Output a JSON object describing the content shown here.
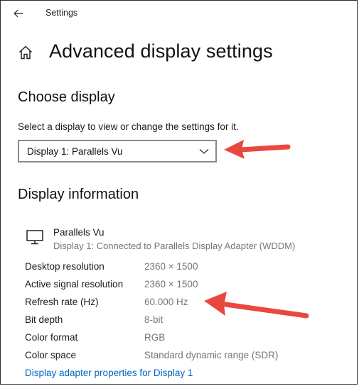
{
  "window": {
    "title": "Settings"
  },
  "page": {
    "title": "Advanced display settings"
  },
  "choose_display": {
    "heading": "Choose display",
    "label": "Select a display to view or change the settings for it.",
    "selected": "Display 1: Parallels Vu"
  },
  "display_info": {
    "heading": "Display information",
    "name": "Parallels Vu",
    "connection": "Display 1: Connected to Parallels Display Adapter (WDDM)",
    "rows": [
      {
        "label": "Desktop resolution",
        "value": "2360 × 1500"
      },
      {
        "label": "Active signal resolution",
        "value": "2360 × 1500"
      },
      {
        "label": "Refresh rate (Hz)",
        "value": "60.000 Hz"
      },
      {
        "label": "Bit depth",
        "value": "8-bit"
      },
      {
        "label": "Color format",
        "value": "RGB"
      },
      {
        "label": "Color space",
        "value": "Standard dynamic range (SDR)"
      }
    ],
    "link": "Display adapter properties for Display 1"
  },
  "icons": {
    "back": "back-arrow-icon",
    "home": "home-icon",
    "dropdown": "chevron-down-icon",
    "monitor": "monitor-icon",
    "annotation": "red-arrow-icon"
  },
  "colors": {
    "link": "#0067c0",
    "secondary_text": "#767676",
    "annotation_arrow": "#e8483f"
  }
}
